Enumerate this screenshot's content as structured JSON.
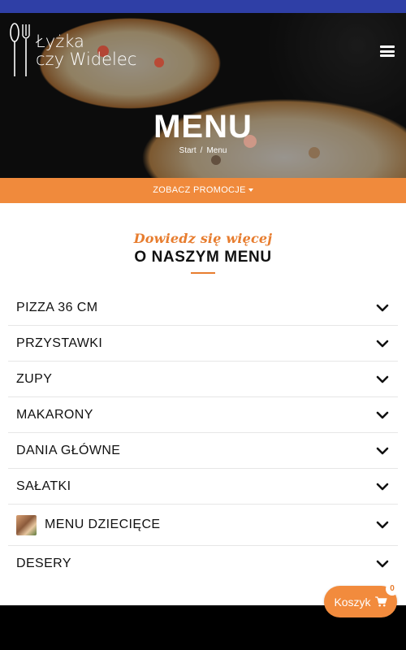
{
  "header": {
    "logo_line1": "Łyżka",
    "logo_line2": "czy Widelec",
    "menu_icon": "hamburger-icon"
  },
  "hero": {
    "title": "MENU",
    "breadcrumb": [
      "Start",
      "Menu"
    ],
    "breadcrumb_separator": "/"
  },
  "promo": {
    "label": "ZOBACZ PROMOCJE",
    "icon": "caret-down-icon"
  },
  "intro": {
    "script_text": "Dowiedz się więcej",
    "heading": "O NASZYM MENU"
  },
  "menu_categories": [
    {
      "label": "PIZZA 36 CM",
      "icon": "chevron-down-icon"
    },
    {
      "label": "PRZYSTAWKI",
      "icon": "chevron-down-icon"
    },
    {
      "label": "ZUPY",
      "icon": "chevron-down-icon"
    },
    {
      "label": "MAKARONY",
      "icon": "chevron-down-icon"
    },
    {
      "label": "DANIA GŁÓWNE",
      "icon": "chevron-down-icon"
    },
    {
      "label": "SAŁATKI",
      "icon": "chevron-down-icon"
    },
    {
      "label": "MENU DZIECIĘCE",
      "icon": "chevron-down-icon",
      "thumbnail": true
    },
    {
      "label": "DESERY",
      "icon": "chevron-down-icon"
    }
  ],
  "cart": {
    "label": "Koszyk",
    "count": "0",
    "icon": "cart-icon"
  },
  "colors": {
    "accent": "#f08a3c",
    "topbar": "#2f3fa6",
    "script_text": "#e77d2f"
  }
}
